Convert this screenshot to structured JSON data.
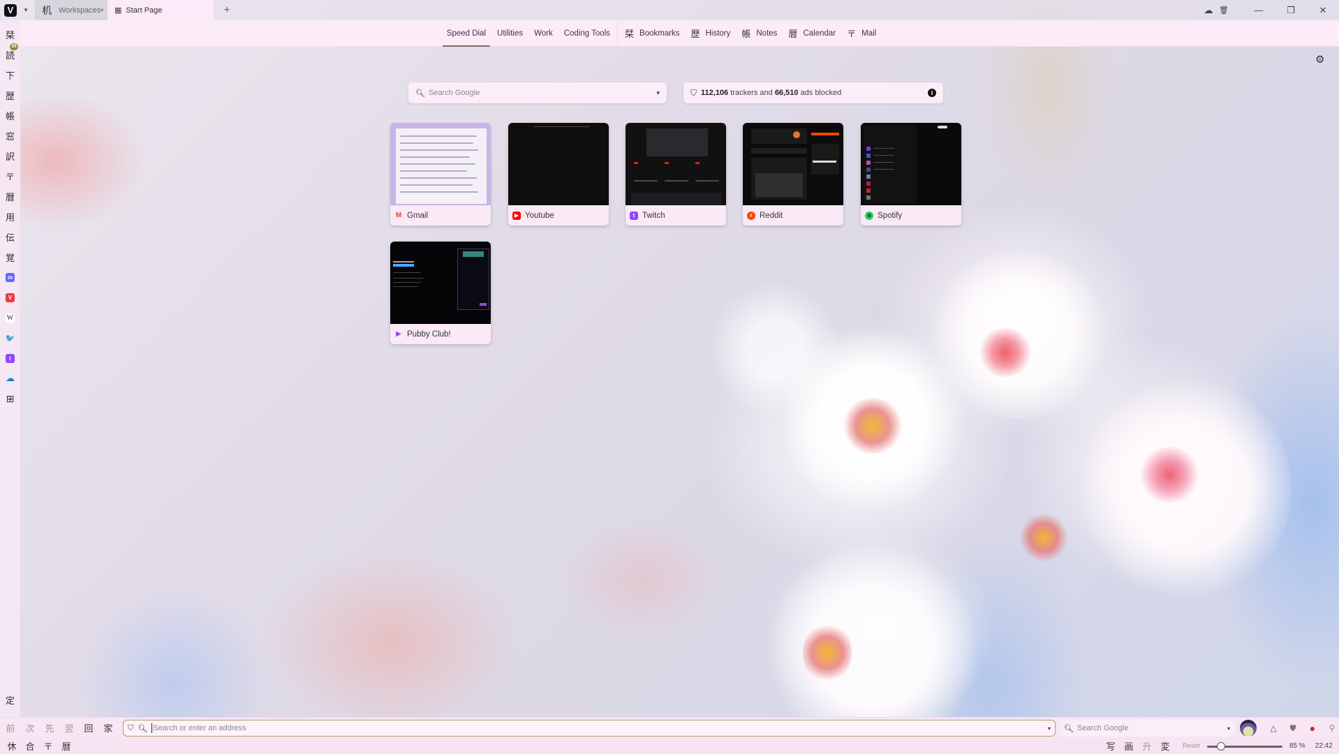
{
  "browser": {
    "logo_glyph": "V",
    "menu_caret": "▾",
    "workspace": {
      "glyph": "机",
      "label": "Workspaces",
      "caret": "▾"
    },
    "tabs": [
      {
        "icon": "speed-dial-grid",
        "glyph": "▦",
        "title": "Start Page",
        "active": true
      }
    ],
    "new_tab_label": "+",
    "window_controls": {
      "sync": "☁",
      "trash": "🗑",
      "minimize": "—",
      "restore": "❐",
      "close": "✕"
    }
  },
  "side_panel": {
    "items": [
      {
        "glyph": "栞",
        "name": "bookmarks"
      },
      {
        "glyph": "読",
        "name": "reading-list",
        "badge": "35"
      },
      {
        "glyph": "下",
        "name": "downloads"
      },
      {
        "glyph": "歴",
        "name": "history"
      },
      {
        "glyph": "帳",
        "name": "notes"
      },
      {
        "glyph": "窓",
        "name": "window"
      },
      {
        "glyph": "訳",
        "name": "translate"
      },
      {
        "glyph": "〒",
        "name": "mail"
      },
      {
        "glyph": "暦",
        "name": "calendar"
      },
      {
        "glyph": "用",
        "name": "tasks"
      },
      {
        "glyph": "伝",
        "name": "feeds"
      },
      {
        "glyph": "覚",
        "name": "contacts"
      }
    ],
    "web_panels": [
      {
        "name": "mastodon",
        "glyph": "m",
        "color": "#6364ff"
      },
      {
        "name": "vivaldi",
        "glyph": "V",
        "color": "#ef3939"
      },
      {
        "name": "wikipedia",
        "glyph": "W",
        "color": "#ffffff"
      },
      {
        "name": "twitter",
        "glyph": "🐦",
        "color": "#1d9bf0"
      },
      {
        "name": "twitch",
        "glyph": "t",
        "color": "#9146ff"
      },
      {
        "name": "onedrive",
        "glyph": "☁",
        "color": "#0a84d8"
      }
    ],
    "add_panel_glyph": "⊞",
    "settings_glyph": "定"
  },
  "speed_dial_nav": {
    "groups": [
      {
        "label": "Speed Dial",
        "active": true
      },
      {
        "label": "Utilities"
      },
      {
        "label": "Work"
      },
      {
        "label": "Coding Tools"
      }
    ],
    "panels": [
      {
        "glyph": "栞",
        "label": "Bookmarks"
      },
      {
        "glyph": "歴",
        "label": "History"
      },
      {
        "glyph": "帳",
        "label": "Notes"
      },
      {
        "glyph": "暦",
        "label": "Calendar"
      },
      {
        "glyph": "〒",
        "label": "Mail"
      }
    ],
    "settings_glyph": "⚙"
  },
  "start_search": {
    "placeholder": "Search Google",
    "icon": "🔍︎",
    "caret": "▾"
  },
  "tracker_blocker": {
    "trackers": "112,106",
    "text_mid": " trackers and ",
    "ads": "66,510",
    "text_end": " ads blocked",
    "info_glyph": "i"
  },
  "speed_dials": [
    {
      "title": "Gmail",
      "favicon": "M",
      "favicon_color": "#ea4335"
    },
    {
      "title": "Youtube",
      "favicon": "▶",
      "favicon_color": "#ff0000"
    },
    {
      "title": "Twitch",
      "favicon": "t",
      "favicon_color": "#9146ff"
    },
    {
      "title": "Reddit",
      "favicon": "r",
      "favicon_color": "#ff4500"
    },
    {
      "title": "Spotify",
      "favicon": "≋",
      "favicon_color": "#1ed760"
    },
    {
      "title": "Pubby Club!",
      "favicon": "▶",
      "favicon_color": "#8e4bd6"
    }
  ],
  "address_bar": {
    "nav": [
      {
        "glyph": "前",
        "name": "back",
        "enabled": false
      },
      {
        "glyph": "次",
        "name": "forward",
        "enabled": false
      },
      {
        "glyph": "先",
        "name": "fast-forward",
        "enabled": false
      },
      {
        "glyph": "翌",
        "name": "rewind",
        "enabled": false
      },
      {
        "glyph": "回",
        "name": "reload",
        "enabled": true
      },
      {
        "glyph": "家",
        "name": "home",
        "enabled": true
      }
    ],
    "url_placeholder": "Search or enter an address",
    "url_value": "",
    "search_placeholder": "Search Google",
    "extensions": [
      {
        "name": "sync",
        "glyph": "△"
      },
      {
        "name": "ublock",
        "glyph": "⛊"
      },
      {
        "name": "record",
        "glyph": "●"
      },
      {
        "name": "extensions",
        "glyph": "⚲"
      }
    ]
  },
  "status_bar": {
    "left": [
      {
        "glyph": "休",
        "name": "hibernate"
      },
      {
        "glyph": "合",
        "name": "tile-tabs"
      },
      {
        "glyph": "〒",
        "name": "mail-status"
      },
      {
        "glyph": "暦",
        "name": "calendar-status"
      }
    ],
    "right": [
      {
        "glyph": "写",
        "name": "capture",
        "dim": false
      },
      {
        "glyph": "画",
        "name": "images",
        "dim": false
      },
      {
        "glyph": "升",
        "name": "page-actions",
        "dim": true
      },
      {
        "glyph": "変",
        "name": "page-tiling",
        "dim": false
      }
    ],
    "reset_label": "Reset",
    "zoom_value": "85 %",
    "zoom_fraction": 0.15,
    "clock": "22:42"
  }
}
